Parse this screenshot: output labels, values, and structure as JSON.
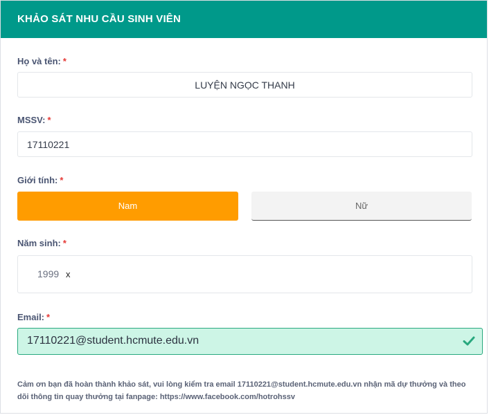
{
  "header": {
    "title": "KHẢO SÁT NHU CẦU SINH VIÊN"
  },
  "form": {
    "required_mark": "*",
    "fullname": {
      "label": "Họ và tên:",
      "value": "LUYỆN NGỌC THANH"
    },
    "mssv": {
      "label": "MSSV:",
      "value": "17110221"
    },
    "gender": {
      "label": "Giới tính:",
      "options": [
        "Nam",
        "Nữ"
      ],
      "selected": "Nam"
    },
    "birth_year": {
      "label": "Năm sinh:",
      "value": "1999",
      "clear": "x"
    },
    "email": {
      "label": "Email:",
      "value": "17110221@student.hcmute.edu.vn",
      "valid_icon": "check-icon"
    }
  },
  "message": "Cảm ơn bạn đã hoàn thành khảo sát, vui lòng kiểm tra email 17110221@student.hcmute.edu.vn nhận mã dự thưởng và theo dõi thông tin quay thưởng tại fanpage: https://www.facebook.com/hotrohssv",
  "colors": {
    "header": "#00998a",
    "selected": "#ff9c00",
    "valid_bg": "#cdf5e6",
    "valid_border": "#28a87e",
    "required": "#e53935"
  }
}
